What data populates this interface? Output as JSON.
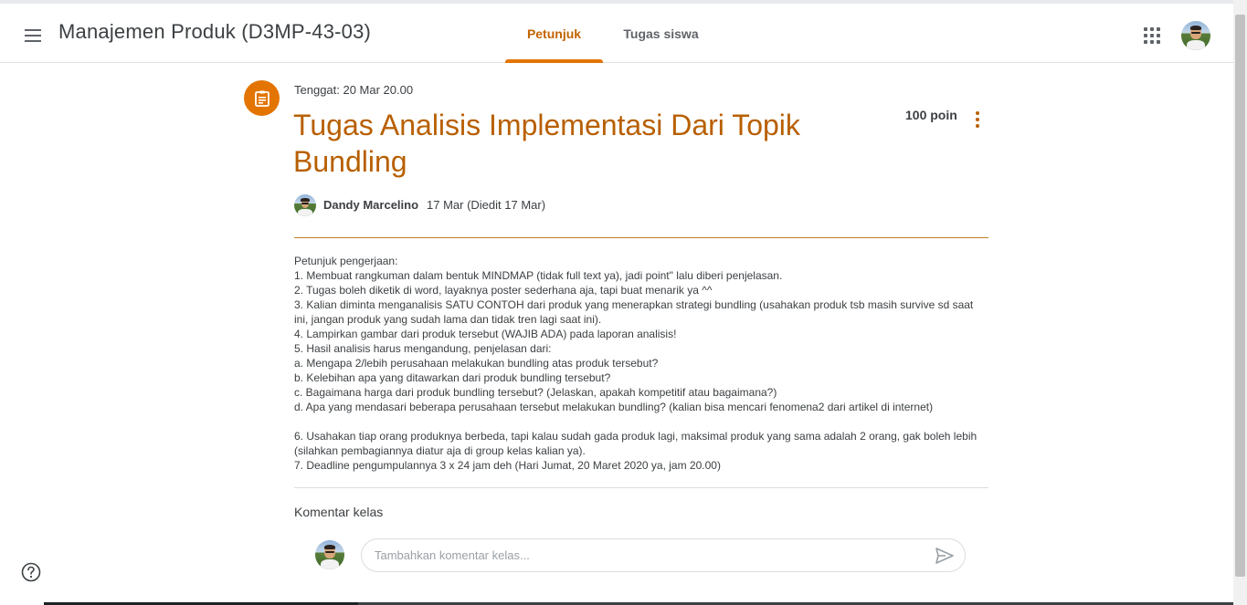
{
  "header": {
    "class_title": "Manajemen Produk (D3MP-43-03)",
    "tabs": [
      {
        "label": "Petunjuk",
        "active": true
      },
      {
        "label": "Tugas siswa",
        "active": false
      }
    ],
    "icons": {
      "menu": "hamburger-menu-icon",
      "apps": "apps-grid-icon",
      "account": "user-avatar"
    }
  },
  "assignment": {
    "due": "Tenggat: 20 Mar 20.00",
    "title": "Tugas Analisis Implementasi Dari Topik Bundling",
    "points": "100 poin",
    "author": "Dandy Marcelino",
    "date": "17 Mar (Diedit 17 Mar)",
    "instructions": "Petunjuk pengerjaan:\n1. Membuat rangkuman dalam bentuk MINDMAP (tidak full text ya), jadi point\" lalu diberi penjelasan.\n2. Tugas boleh diketik di word, layaknya poster sederhana aja, tapi buat menarik ya ^^\n3. Kalian diminta menganalisis SATU CONTOH dari produk yang menerapkan strategi bundling (usahakan produk tsb masih survive sd saat ini, jangan produk yang sudah lama dan tidak tren lagi saat ini).\n4. Lampirkan gambar dari produk tersebut (WAJIB ADA) pada laporan analisis!\n5. Hasil analisis harus mengandung, penjelasan dari:\na. Mengapa 2/lebih perusahaan melakukan bundling atas produk tersebut?\nb. Kelebihan apa yang ditawarkan dari produk bundling tersebut?\nc. Bagaimana harga dari produk bundling tersebut? (Jelaskan, apakah kompetitif atau bagaimana?)\nd. Apa yang mendasari beberapa perusahaan tersebut melakukan bundling? (kalian bisa mencari fenomena2 dari artikel di internet)\n\n6. Usahakan tiap orang produknya berbeda, tapi kalau sudah gada produk lagi, maksimal produk yang sama adalah 2 orang, gak boleh lebih (silahkan pembagiannya diatur aja di group kelas kalian ya).\n7. Deadline pengumpulannya 3 x 24 jam deh (Hari Jumat, 20 Maret 2020 ya, jam 20.00)"
  },
  "comments": {
    "heading": "Komentar kelas",
    "input_placeholder": "Tambahkan komentar kelas...",
    "input_value": ""
  },
  "colors": {
    "accent": "#e37400",
    "title": "#b85f00",
    "text": "#3c4043"
  }
}
